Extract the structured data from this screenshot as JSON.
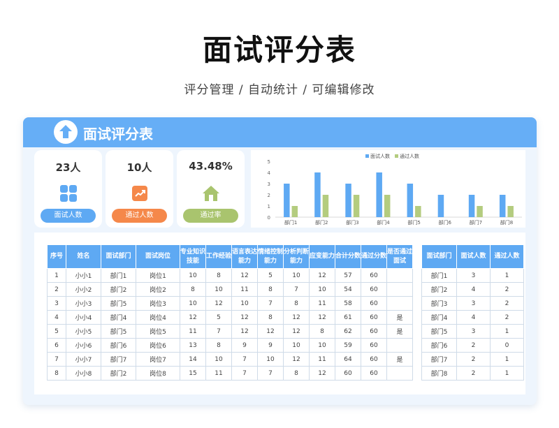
{
  "hero": {
    "title": "面试评分表",
    "subtitle": "评分管理 / 自动统计 / 可编辑修改"
  },
  "header": {
    "title": "面试评分表",
    "logo_icon": "upload-arrow-icon"
  },
  "kpis": [
    {
      "value": "23人",
      "label": "面试人数",
      "icon": "grid-icon",
      "color": "#5ea9f3"
    },
    {
      "value": "10人",
      "label": "通过人数",
      "icon": "trend-up-icon",
      "color": "#f5884a"
    },
    {
      "value": "43.48%",
      "label": "通过率",
      "icon": "house-icon",
      "color": "#a9c46e"
    }
  ],
  "chart_data": {
    "type": "bar",
    "categories": [
      "部门1",
      "部门2",
      "部门3",
      "部门4",
      "部门5",
      "部门6",
      "部门7",
      "部门8"
    ],
    "series": [
      {
        "name": "面试人数",
        "values": [
          3,
          4,
          3,
          4,
          3,
          2,
          2,
          2
        ],
        "color": "#5ea9f3"
      },
      {
        "name": "通过人数",
        "values": [
          1,
          2,
          2,
          2,
          1,
          0,
          1,
          1
        ],
        "color": "#b4cc7f"
      }
    ],
    "ylim": [
      0,
      5
    ],
    "yticks": [
      "0",
      "1",
      "2",
      "3",
      "4",
      "5"
    ],
    "legend": "top-center",
    "grid": false
  },
  "main_table": {
    "headers": [
      "序号",
      "姓名",
      "面试部门",
      "面试岗位",
      "专业知识技能",
      "工作经验",
      "语言表达能力",
      "情绪控制能力",
      "分析判断能力",
      "应变能力",
      "合计分数",
      "通过分数",
      "是否通过面试"
    ],
    "rows": [
      [
        "1",
        "小小1",
        "部门1",
        "岗位1",
        "10",
        "8",
        "12",
        "5",
        "10",
        "12",
        "57",
        "60",
        ""
      ],
      [
        "2",
        "小小2",
        "部门2",
        "岗位2",
        "8",
        "10",
        "11",
        "8",
        "7",
        "10",
        "54",
        "60",
        ""
      ],
      [
        "3",
        "小小3",
        "部门5",
        "岗位3",
        "10",
        "12",
        "10",
        "7",
        "8",
        "11",
        "58",
        "60",
        ""
      ],
      [
        "4",
        "小小4",
        "部门4",
        "岗位4",
        "12",
        "5",
        "12",
        "8",
        "12",
        "12",
        "61",
        "60",
        "是"
      ],
      [
        "5",
        "小小5",
        "部门5",
        "岗位5",
        "11",
        "7",
        "12",
        "12",
        "12",
        "8",
        "62",
        "60",
        "是"
      ],
      [
        "6",
        "小小6",
        "部门6",
        "岗位6",
        "13",
        "8",
        "9",
        "9",
        "10",
        "10",
        "59",
        "60",
        ""
      ],
      [
        "7",
        "小小7",
        "部门7",
        "岗位7",
        "14",
        "10",
        "7",
        "10",
        "12",
        "11",
        "64",
        "60",
        "是"
      ],
      [
        "8",
        "小小8",
        "部门2",
        "岗位8",
        "15",
        "11",
        "7",
        "7",
        "8",
        "12",
        "60",
        "60",
        ""
      ]
    ]
  },
  "dept_table": {
    "headers": [
      "面试部门",
      "面试人数",
      "通过人数"
    ],
    "rows": [
      [
        "部门1",
        "3",
        "1"
      ],
      [
        "部门2",
        "4",
        "2"
      ],
      [
        "部门3",
        "3",
        "2"
      ],
      [
        "部门4",
        "4",
        "2"
      ],
      [
        "部门5",
        "3",
        "1"
      ],
      [
        "部门6",
        "2",
        "0"
      ],
      [
        "部门7",
        "2",
        "1"
      ],
      [
        "部门8",
        "2",
        "1"
      ]
    ]
  }
}
